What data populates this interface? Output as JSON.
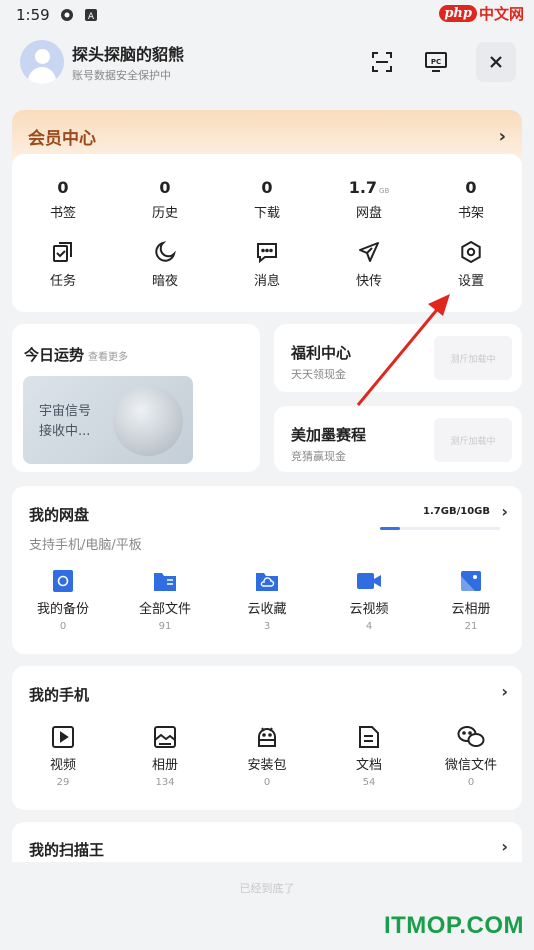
{
  "status_bar": {
    "time": "1:59"
  },
  "watermark_top": {
    "php": "php",
    "cn": "中文网"
  },
  "user": {
    "name": "探头探脑的貂熊",
    "subtitle": "账号数据安全保护中"
  },
  "member": {
    "title": "会员中心"
  },
  "stats": [
    {
      "value": "0",
      "unit": "",
      "label": "书签"
    },
    {
      "value": "0",
      "unit": "",
      "label": "历史"
    },
    {
      "value": "0",
      "unit": "",
      "label": "下载"
    },
    {
      "value": "1.7",
      "unit": "GB",
      "label": "网盘"
    },
    {
      "value": "0",
      "unit": "",
      "label": "书架"
    }
  ],
  "tools": [
    {
      "label": "任务",
      "icon": "task-icon"
    },
    {
      "label": "暗夜",
      "icon": "moon-icon"
    },
    {
      "label": "消息",
      "icon": "message-icon"
    },
    {
      "label": "快传",
      "icon": "send-icon"
    },
    {
      "label": "设置",
      "icon": "settings-icon"
    }
  ],
  "fortune": {
    "title": "今日运势",
    "more": "查看更多",
    "line1": "宇宙信号",
    "line2": "接收中..."
  },
  "welfare": {
    "title": "福利中心",
    "subtitle": "天天领现金",
    "button": "测斤加载中"
  },
  "bonus": {
    "title": "美加墨赛程",
    "subtitle": "竞猜赢现金",
    "button": "测斤加载中"
  },
  "disk": {
    "title": "我的网盘",
    "subtitle": "支持手机/电脑/平板",
    "usage": "1.7GB/10GB",
    "usage_fraction": 0.17,
    "items": [
      {
        "label": "我的备份",
        "count": "0",
        "icon": "backup-icon"
      },
      {
        "label": "全部文件",
        "count": "91",
        "icon": "folder-icon"
      },
      {
        "label": "云收藏",
        "count": "3",
        "icon": "cloud-folder-icon"
      },
      {
        "label": "云视频",
        "count": "4",
        "icon": "video-icon"
      },
      {
        "label": "云相册",
        "count": "21",
        "icon": "photo-icon"
      }
    ]
  },
  "phone": {
    "title": "我的手机",
    "items": [
      {
        "label": "视频",
        "count": "29",
        "icon": "play-icon"
      },
      {
        "label": "相册",
        "count": "134",
        "icon": "album-icon"
      },
      {
        "label": "安装包",
        "count": "0",
        "icon": "android-icon"
      },
      {
        "label": "文档",
        "count": "54",
        "icon": "document-icon"
      },
      {
        "label": "微信文件",
        "count": "0",
        "icon": "wechat-icon"
      }
    ]
  },
  "scanner": {
    "title": "我的扫描王"
  },
  "end_text": "已经到底了",
  "watermark_bottom": "ITMOP.COM",
  "colors": {
    "accent": "#3a6fe6",
    "member_text": "#9a4a1c",
    "arrow": "#e0271f",
    "watermark_green": "#1b9e4b"
  }
}
